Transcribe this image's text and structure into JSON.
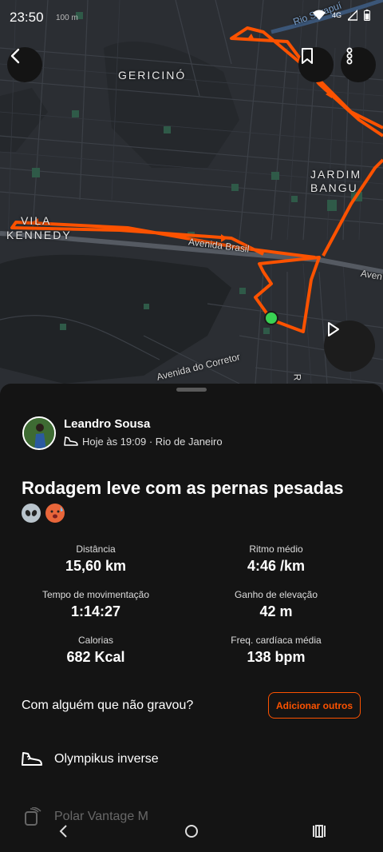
{
  "status_bar": {
    "time": "23:50",
    "map_scale": "100 m",
    "network": "4G"
  },
  "map": {
    "labels": {
      "gericino": "GERICINÓ",
      "jardim": "JARDIM",
      "bangu": "BANGU",
      "vila": "VILA",
      "kennedy": "KENNEDY"
    },
    "streets": {
      "avenida_brasil": "Avenida Brasil",
      "avenida_brasil_cut": "Aven",
      "corretor": "Avenida do Corretor",
      "rio": "Rio Sarapuí",
      "r": "R"
    }
  },
  "activity": {
    "user_name": "Leandro Sousa",
    "date_location": "Hoje às 19:09 · Rio de Janeiro",
    "title": "Rodagem leve com as pernas pesadas"
  },
  "stats": [
    {
      "label": "Distância",
      "value": "15,60 km"
    },
    {
      "label": "Ritmo médio",
      "value": "4:46 /km"
    },
    {
      "label": "Tempo de movimentação",
      "value": "1:14:27"
    },
    {
      "label": "Ganho de elevação",
      "value": "42 m"
    },
    {
      "label": "Calorias",
      "value": "682 Kcal"
    },
    {
      "label": "Freq. cardíaca média",
      "value": "138 bpm"
    }
  ],
  "with_others": {
    "text": "Com alguém que não gravou?",
    "button": "Adicionar outros"
  },
  "gear": [
    {
      "name": "Olympikus inverse"
    },
    {
      "name": "Polar Vantage M"
    }
  ],
  "colors": {
    "accent": "#fc5200",
    "background": "#141414",
    "map_bg": "#2b2e33"
  }
}
